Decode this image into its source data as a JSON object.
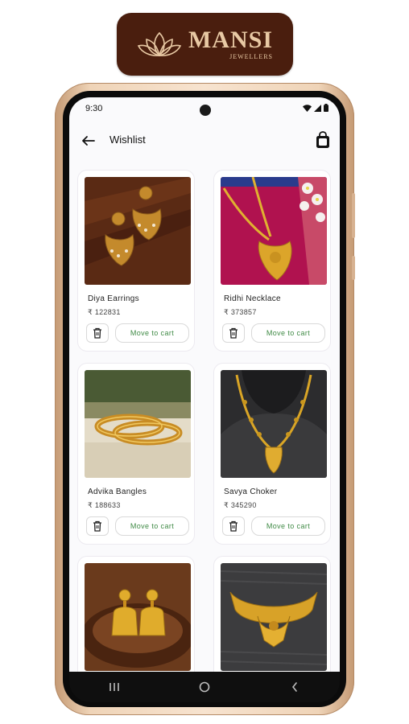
{
  "brand": {
    "name": "MANSI",
    "subtitle": "JEWELLERS"
  },
  "status_bar": {
    "time": "9:30"
  },
  "app_bar": {
    "title": "Wishlist"
  },
  "wishlist": {
    "items": [
      {
        "name": "Diya Earrings",
        "price": "₹ 122831",
        "image": "gold-chandbali-earrings"
      },
      {
        "name": "Ridhi Necklace",
        "price": "₹ 373857",
        "image": "gold-pendant-necklace"
      },
      {
        "name": "Advika Bangles",
        "price": "₹ 188633",
        "image": "gold-bangles"
      },
      {
        "name": "Savya Choker",
        "price": "₹ 345290",
        "image": "gold-long-necklace"
      },
      {
        "name": "",
        "price": "",
        "image": "gold-jhumka-earrings"
      },
      {
        "name": "",
        "price": "",
        "image": "gold-choker"
      }
    ],
    "move_to_cart_label": "Move to cart"
  },
  "colors": {
    "brand_bg": "#4a1e0e",
    "brand_text": "#e8c9a4",
    "cart_text": "#3f8a45",
    "frame": "#efd4b8"
  }
}
